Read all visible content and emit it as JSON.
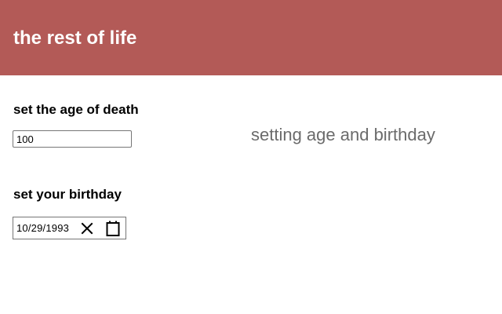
{
  "header": {
    "title": "the rest of life",
    "background_color": "#b35a57",
    "text_color": "#ffffff"
  },
  "age_section": {
    "label": "set the age of death",
    "input_value": "100"
  },
  "birthday_section": {
    "label": "set your birthday",
    "date_value": "10/29/1993",
    "clear_icon": "close-icon",
    "calendar_icon": "calendar-icon"
  },
  "side_note": {
    "text": "setting age and birthday",
    "color": "#6b6b6b"
  }
}
